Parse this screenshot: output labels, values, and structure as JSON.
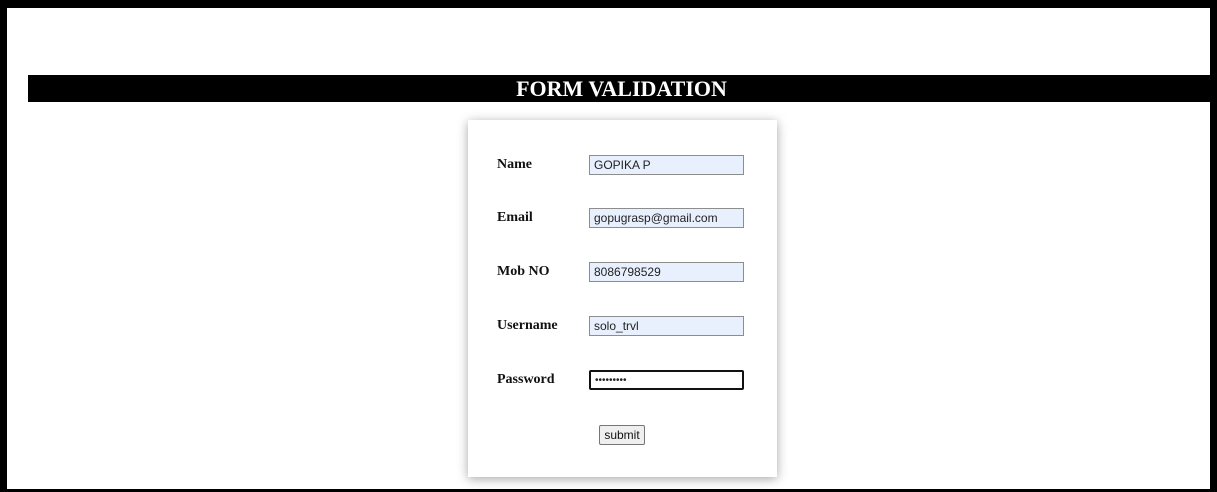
{
  "page": {
    "title": "FORM VALIDATION"
  },
  "form": {
    "fields": [
      {
        "label": "Name",
        "value": "GOPIKA P",
        "type": "text"
      },
      {
        "label": "Email",
        "value": "gopugrasp@gmail.com",
        "type": "text"
      },
      {
        "label": "Mob NO",
        "value": "8086798529",
        "type": "text"
      },
      {
        "label": "Username",
        "value": "solo_trvl",
        "type": "text"
      },
      {
        "label": "Password",
        "value": "•••••••••",
        "type": "password"
      }
    ],
    "submit_label": "submit"
  }
}
